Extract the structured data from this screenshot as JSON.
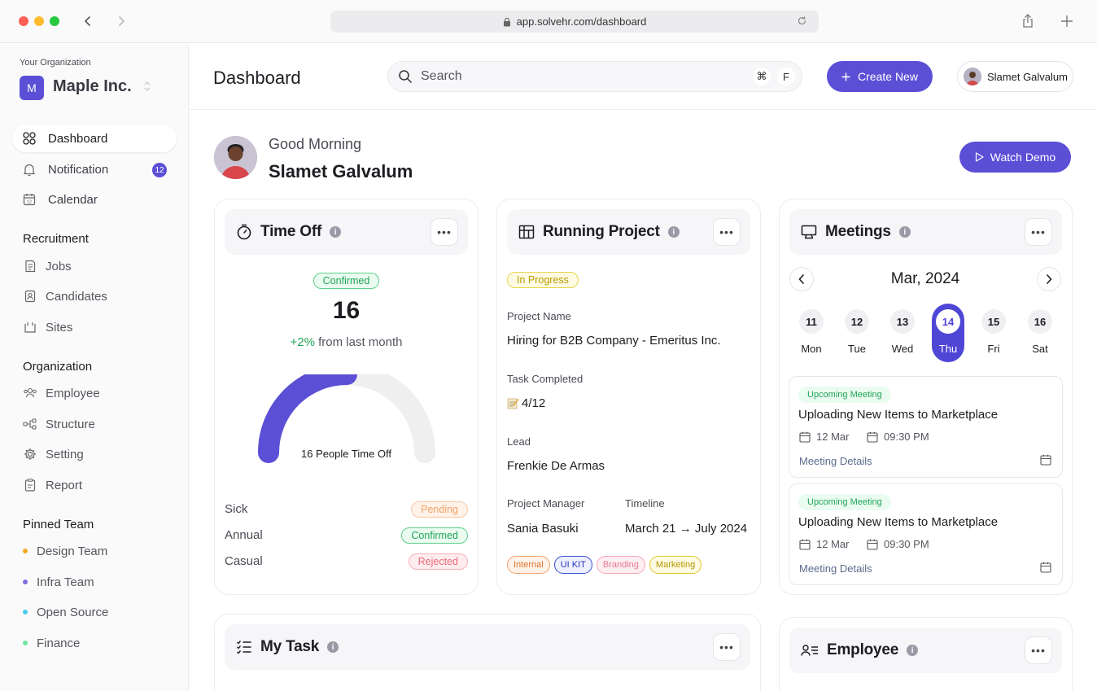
{
  "browser": {
    "url": "app.solvehr.com/dashboard"
  },
  "sidebar": {
    "org_label": "Your Organization",
    "org_initial": "M",
    "org_name": "Maple Inc.",
    "main_items": [
      {
        "label": "Dashboard",
        "icon": "grid-icon",
        "active": true
      },
      {
        "label": "Notification",
        "icon": "bell-icon",
        "badge": "12"
      },
      {
        "label": "Calendar",
        "icon": "calendar-icon"
      }
    ],
    "recruitment_title": "Recruitment",
    "recruitment_items": [
      {
        "label": "Jobs",
        "icon": "document-icon"
      },
      {
        "label": "Candidates",
        "icon": "id-card-icon"
      },
      {
        "label": "Sites",
        "icon": "site-icon"
      }
    ],
    "organization_title": "Organization",
    "organization_items": [
      {
        "label": "Employee",
        "icon": "users-icon"
      },
      {
        "label": "Structure",
        "icon": "structure-icon"
      },
      {
        "label": "Setting",
        "icon": "gear-icon"
      },
      {
        "label": "Report",
        "icon": "report-icon"
      }
    ],
    "pinned_title": "Pinned Team",
    "pinned_items": [
      {
        "label": "Design Team",
        "color": "#f5a623"
      },
      {
        "label": "Infra Team",
        "color": "#7b6fe0"
      },
      {
        "label": "Open Source",
        "color": "#4cc9f0"
      },
      {
        "label": "Finance",
        "color": "#6fe3a0"
      }
    ]
  },
  "header": {
    "title": "Dashboard",
    "search_placeholder": "Search",
    "shortcut_cmd": "⌘",
    "shortcut_key": "F",
    "create_label": "Create New",
    "user_name": "Slamet Galvalum"
  },
  "greeting": {
    "line1": "Good Morning",
    "name": "Slamet Galvalum",
    "watch_demo": "Watch Demo"
  },
  "time_off": {
    "title": "Time Off",
    "status": "Confirmed",
    "count": "16",
    "change_value": "+2%",
    "change_text": "from last month",
    "gauge_label": "16 People Time Off",
    "gauge_fraction": 0.5,
    "rows": [
      {
        "label": "Sick",
        "status": "Pending",
        "kind": "orange"
      },
      {
        "label": "Annual",
        "status": "Confirmed",
        "kind": "green"
      },
      {
        "label": "Casual",
        "status": "Rejected",
        "kind": "red"
      }
    ]
  },
  "project": {
    "title": "Running Project",
    "status": "In Progress",
    "name_label": "Project Name",
    "name_value": "Hiring for B2B Company - Emeritus Inc.",
    "task_label": "Task Completed",
    "task_value": "4/12",
    "lead_label": "Lead",
    "lead_value": "Frenkie De Armas",
    "pm_label": "Project Manager",
    "pm_value": "Sania Basuki",
    "timeline_label": "Timeline",
    "timeline_value": "March 21 → July 2024",
    "tags": [
      "Internal",
      "UI KIT",
      "Branding",
      "Marketing"
    ]
  },
  "meetings": {
    "title": "Meetings",
    "month": "Mar, 2024",
    "days": [
      {
        "num": "11",
        "name": "Mon"
      },
      {
        "num": "12",
        "name": "Tue"
      },
      {
        "num": "13",
        "name": "Wed"
      },
      {
        "num": "14",
        "name": "Thu",
        "active": true
      },
      {
        "num": "15",
        "name": "Fri"
      },
      {
        "num": "16",
        "name": "Sat"
      }
    ],
    "items": [
      {
        "badge": "Upcoming Meeting",
        "title": "Uploading New Items to Marketplace",
        "date": "12 Mar",
        "time": "09:30 PM",
        "link": "Meeting Details"
      },
      {
        "badge": "Upcoming Meeting",
        "title": "Uploading New Items to Marketplace",
        "date": "12 Mar",
        "time": "09:30 PM",
        "link": "Meeting Details"
      }
    ]
  },
  "my_task": {
    "title": "My Task"
  },
  "employee": {
    "title": "Employee"
  },
  "colors": {
    "accent": "#5b4fd6",
    "gauge_track": "#efefef"
  }
}
